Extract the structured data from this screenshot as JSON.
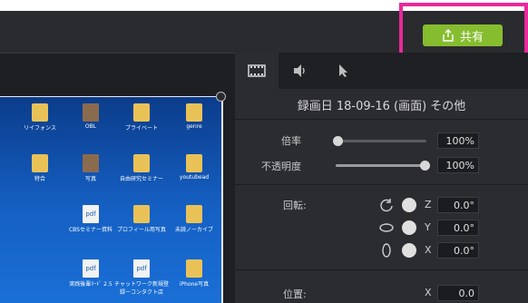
{
  "toolbar": {
    "share_label": "共有"
  },
  "panel": {
    "tabs": [
      "film-icon",
      "speaker-icon",
      "cursor-icon"
    ],
    "title": "録画日 18-09-16 (画面) その他",
    "scale": {
      "label": "倍率",
      "value": "100%",
      "level": 0.0
    },
    "opacity": {
      "label": "不透明度",
      "value": "100%",
      "level": 1.0
    },
    "rotation": {
      "label": "回転:",
      "z": {
        "axis": "Z",
        "value": "0.0°"
      },
      "y": {
        "axis": "Y",
        "value": "0.0°"
      },
      "x": {
        "axis": "X",
        "value": "0.0°"
      }
    },
    "position": {
      "label": "位置:",
      "x": {
        "axis": "X",
        "value": "0.0"
      }
    }
  },
  "desktop_icons": [
    {
      "label": "リイフォンス",
      "kind": "folder"
    },
    {
      "label": "OBL",
      "kind": "photo"
    },
    {
      "label": "プライベート",
      "kind": "folder"
    },
    {
      "label": "genre",
      "kind": "folder"
    },
    {
      "label": "特合",
      "kind": "folder"
    },
    {
      "label": "写真",
      "kind": "photo"
    },
    {
      "label": "自由研究セミナー",
      "kind": "folder"
    },
    {
      "label": "youtubead",
      "kind": "folder"
    },
    {
      "label": "CBSセミナー資料",
      "kind": "pdf"
    },
    {
      "label": "プロフィール用写真",
      "kind": "folder"
    },
    {
      "label": "未読ノーカイブ",
      "kind": "folder"
    },
    {
      "label": "実践後輩ﾘｰﾄﾞ 2.5",
      "kind": "pdf"
    },
    {
      "label": "チャットワーク新規登録ーコンタクト店",
      "kind": "pdf"
    },
    {
      "label": "iPhone写真",
      "kind": "folder"
    }
  ],
  "colors": {
    "accent": "#86bd2f",
    "highlight": "#e8299a",
    "panel": "#2b2c30"
  }
}
